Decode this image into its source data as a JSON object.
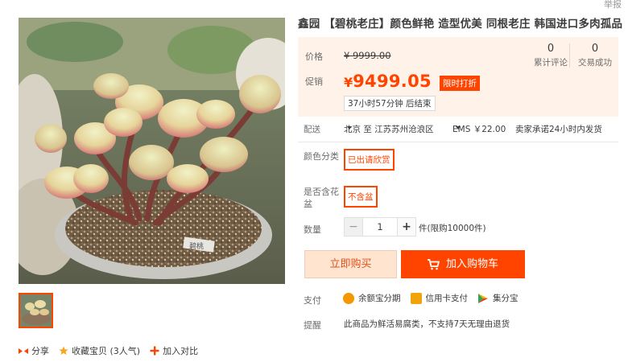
{
  "top": {
    "report_label": "举报"
  },
  "product": {
    "title": "鑫园 【碧桃老庄】颜色鲜艳 造型优美 同根老庄 韩国进口多肉孤品",
    "plant_label": "碧桃"
  },
  "price": {
    "label": "价格",
    "original": "¥ 9999.00",
    "promo_label": "促销",
    "promo_currency": "¥",
    "promo_value": "9499.05",
    "sale_tag": "限时打折",
    "timer": "37小时57分钟 后结束"
  },
  "stats": [
    {
      "count": "0",
      "label": "累计评论"
    },
    {
      "count": "0",
      "label": "交易成功"
    }
  ],
  "shipping": {
    "label": "配送",
    "route": "北京 至  江苏苏州沧浪区",
    "method": "EMS ￥22.00",
    "promise": "卖家承诺24小时内发货"
  },
  "options": {
    "color_label": "颜色分类",
    "color_value": "已出请欣赏",
    "pot_label_line1": "是否含花",
    "pot_label_line2": "盆",
    "pot_value": "不含盆"
  },
  "quantity": {
    "label": "数量",
    "minus": "−",
    "value": "1",
    "plus": "+",
    "limit": "件(限购10000件)"
  },
  "buttons": {
    "buy_now": "立即购买",
    "add_to_cart": "加入购物车"
  },
  "payment": {
    "label": "支付",
    "methods": [
      {
        "name": "余额宝分期",
        "icon": "yuebao-icon",
        "color": "#f39800"
      },
      {
        "name": "信用卡支付",
        "icon": "credit-card-icon",
        "color": "#f0a30a"
      },
      {
        "name": "集分宝",
        "icon": "jifenbao-icon",
        "color": "#2fa84f"
      }
    ]
  },
  "notice": {
    "label": "提醒",
    "text": "此商品为鲜活易腐类，不支持7天无理由退货"
  },
  "social": {
    "share": "分享",
    "favorite": "收藏宝贝 (3人气)",
    "compare": "加入对比"
  },
  "colors": {
    "accent": "#ff4400",
    "price_bg": "#fff2e8",
    "buy_bg": "#ffe4d0"
  }
}
